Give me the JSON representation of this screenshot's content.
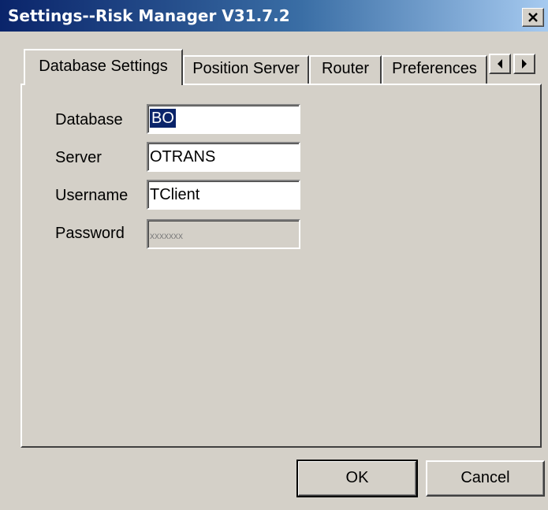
{
  "window": {
    "title": "Settings--Risk Manager V31.7.2",
    "close_label": "close"
  },
  "tabs": [
    {
      "label": "Database Settings",
      "active": true
    },
    {
      "label": "Position Server",
      "active": false
    },
    {
      "label": "Router",
      "active": false
    },
    {
      "label": "Preferences",
      "active": false
    }
  ],
  "tab_scroll": {
    "left_icon": "arrow-left-icon",
    "right_icon": "arrow-right-icon"
  },
  "form": {
    "database_label": "Database",
    "database_value": "BO",
    "server_label": "Server",
    "server_value": "OTRANS",
    "username_label": "Username",
    "username_value": "TClient",
    "password_label": "Password",
    "password_value": "xxxxxxx"
  },
  "buttons": {
    "ok_label": "OK",
    "cancel_label": "Cancel"
  },
  "colors": {
    "titlebar_start": "#0a246a",
    "titlebar_end": "#a6caf0",
    "face": "#d4d0c8",
    "selection": "#0a246a"
  }
}
